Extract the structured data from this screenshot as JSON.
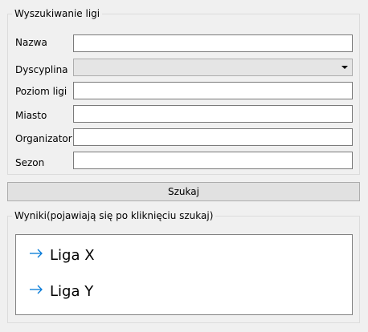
{
  "search": {
    "title": "Wyszukiwanie ligi",
    "fields": {
      "name": {
        "label": "Nazwa",
        "value": ""
      },
      "discipline": {
        "label": "Dyscyplina",
        "value": ""
      },
      "level": {
        "label": "Poziom ligi",
        "value": ""
      },
      "city": {
        "label": "Miasto",
        "value": ""
      },
      "organizer": {
        "label": "Organizator",
        "value": ""
      },
      "season": {
        "label": "Sezon",
        "value": ""
      }
    },
    "button_label": "Szukaj"
  },
  "results": {
    "title": "Wyniki(pojawiają się po kliknięciu szukaj)",
    "icon": "arrow-right-icon",
    "icon_color": "#0078d7",
    "items": [
      {
        "label": "Liga X"
      },
      {
        "label": "Liga Y"
      }
    ]
  }
}
